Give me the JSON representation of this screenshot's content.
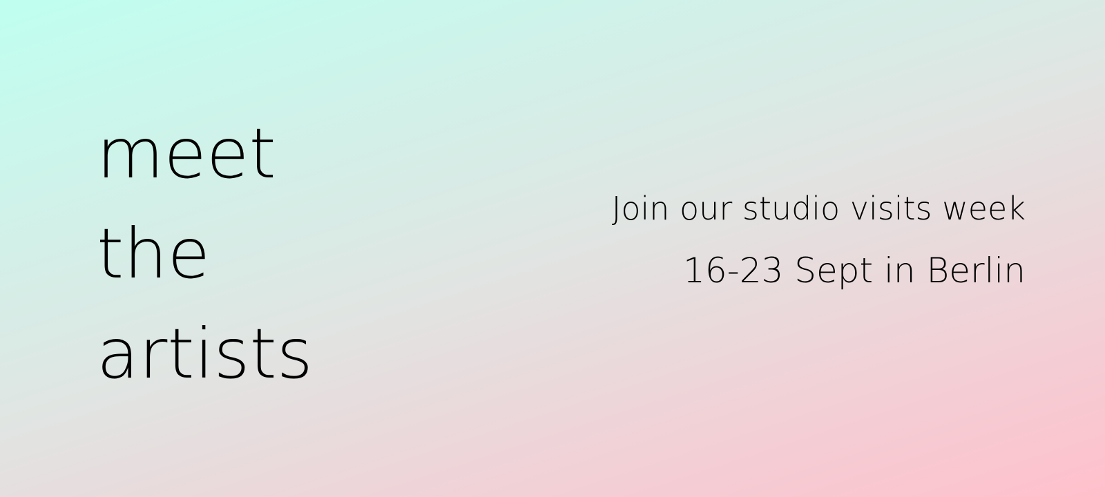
{
  "banner": {
    "headline": [
      "meet",
      "the",
      "artists"
    ],
    "tagline": "Join our studio visits week",
    "dates": "16-23 Sept in Berlin"
  },
  "colors": {
    "gradient_top_right": "#bffff0",
    "gradient_middle": "#dfe6e3",
    "gradient_bottom_left": "#ffc0cc",
    "text": "#000000"
  }
}
